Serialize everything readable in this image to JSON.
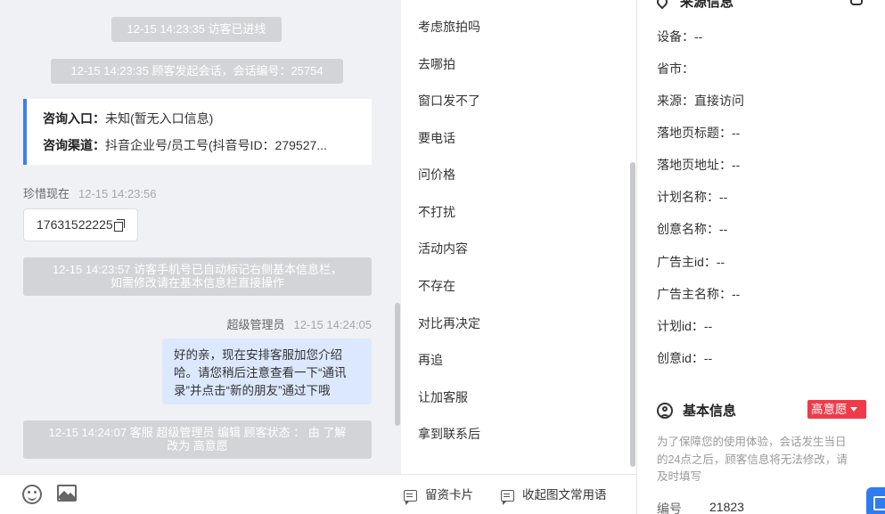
{
  "chat": {
    "system_messages": [
      "12-15 14:23:35 访客已进线",
      "12-15 14:23:35 顾客发起会话，会话编号：25754"
    ],
    "info_card": {
      "entry_label": "咨询入口：",
      "entry_value": "未知(暂无入口信息)",
      "channel_label": "咨询渠道：",
      "channel_value": "抖音企业号/员工号(抖音号ID：279527..."
    },
    "visitor_msg": {
      "sender": "珍惜现在",
      "time": "12-15 14:23:56",
      "phone": "17631522225"
    },
    "auto_notice": {
      "line1": "12-15 14:23:57 访客手机号已自动标记右侧基本信息栏，",
      "line2": "如需修改请在基本信息栏直接操作"
    },
    "agent_msg": {
      "sender": "超级管理员",
      "time": "12-15 14:24:05",
      "line1": "好的亲，现在安排客服加您介绍",
      "line2": "哈。请您稍后注意查看一下“通讯",
      "line3": "录”并点击“新的朋友”通过下哦"
    },
    "status_notice": {
      "line1": "12-15 14:24:07 客服 超级管理员 编辑 顾客状态 ： 由 了解",
      "line2": "改为 高意愿"
    }
  },
  "toolbar": {
    "emoji_icon": "emoji-icon",
    "image_icon": "image-icon"
  },
  "quick_replies": {
    "items": [
      "考虑旅拍吗",
      "去哪拍",
      "窗口发不了",
      "要电话",
      "问价格",
      "不打扰",
      "活动内容",
      "不存在",
      "对比再决定",
      "再追",
      "让加客服",
      "拿到联系后"
    ],
    "footer_card": "留资卡片",
    "footer_collapse": "收起图文常用语"
  },
  "source_info": {
    "title": "来源信息",
    "device": "设备：--",
    "province": "省市：",
    "source": "来源：直接访问",
    "landing_title": "落地页标题：--",
    "landing_url": "落地页地址：--",
    "plan_name": "计划名称：--",
    "creative_name": "创意名称：--",
    "advertiser_id": "广告主id：--",
    "advertiser_name": "广告主名称：--",
    "plan_id": "计划id：--",
    "creative_id": "创意id：--"
  },
  "basic_info": {
    "title": "基本信息",
    "intent_badge": "高意愿",
    "note_line1": "为了保障您的使用体验，会话发生当日",
    "note_line2": "的24点之后，顾客信息将无法修改，请",
    "note_line3": "及时填写",
    "id_label": "编号",
    "id_value": "21823"
  },
  "colors": {
    "accent_blue": "#3d7ef0",
    "agent_bubble": "#dce8fd",
    "badge_red": "#ef3b49",
    "chat_bg": "#f0f1f5"
  }
}
